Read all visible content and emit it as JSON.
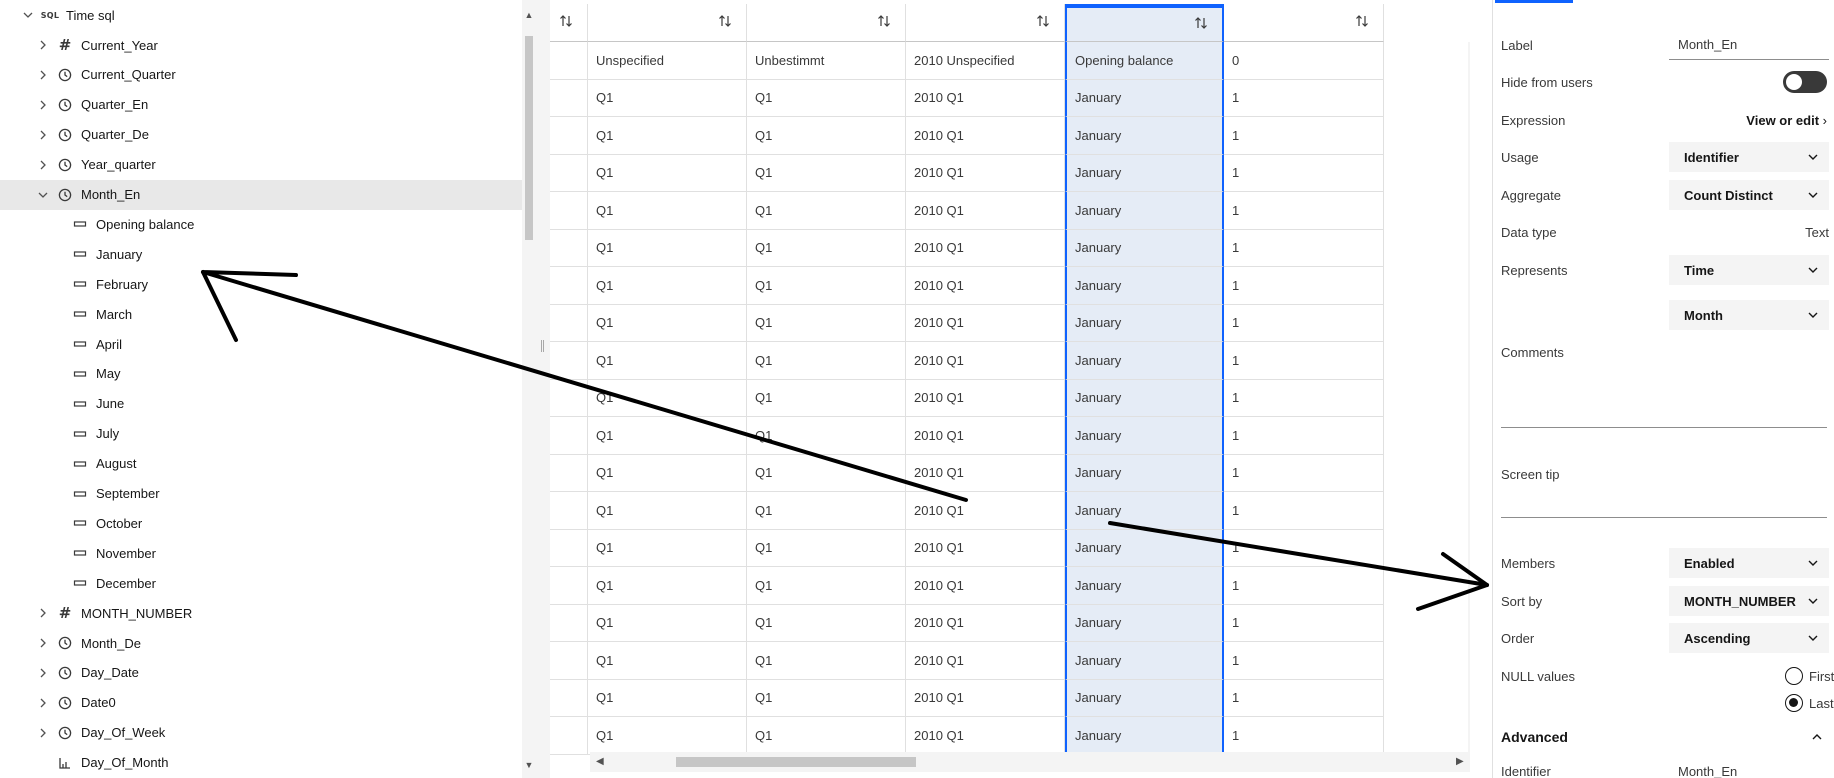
{
  "tree": {
    "root_label": "Time sql",
    "root_badge": "SQL",
    "items": [
      {
        "label": "Current_Year",
        "icon": "hash-icon",
        "expandable": true
      },
      {
        "label": "Current_Quarter",
        "icon": "clock-icon",
        "expandable": true
      },
      {
        "label": "Quarter_En",
        "icon": "clock-icon",
        "expandable": true
      },
      {
        "label": "Quarter_De",
        "icon": "clock-icon",
        "expandable": true
      },
      {
        "label": "Year_quarter",
        "icon": "clock-icon",
        "expandable": true
      },
      {
        "label": "Month_En",
        "icon": "clock-icon",
        "expandable": true,
        "expanded": true,
        "selected": true
      },
      {
        "label": "Opening balance",
        "icon": "member-icon",
        "child": true
      },
      {
        "label": "January",
        "icon": "member-icon",
        "child": true
      },
      {
        "label": "February",
        "icon": "member-icon",
        "child": true
      },
      {
        "label": "March",
        "icon": "member-icon",
        "child": true
      },
      {
        "label": "April",
        "icon": "member-icon",
        "child": true
      },
      {
        "label": "May",
        "icon": "member-icon",
        "child": true
      },
      {
        "label": "June",
        "icon": "member-icon",
        "child": true
      },
      {
        "label": "July",
        "icon": "member-icon",
        "child": true
      },
      {
        "label": "August",
        "icon": "member-icon",
        "child": true
      },
      {
        "label": "September",
        "icon": "member-icon",
        "child": true
      },
      {
        "label": "October",
        "icon": "member-icon",
        "child": true
      },
      {
        "label": "November",
        "icon": "member-icon",
        "child": true
      },
      {
        "label": "December",
        "icon": "member-icon",
        "child": true
      },
      {
        "label": "MONTH_NUMBER",
        "icon": "hash-icon",
        "expandable": true
      },
      {
        "label": "Month_De",
        "icon": "clock-icon",
        "expandable": true
      },
      {
        "label": "Day_Date",
        "icon": "clock-icon",
        "expandable": true
      },
      {
        "label": "Date0",
        "icon": "clock-icon",
        "expandable": true
      },
      {
        "label": "Day_Of_Week",
        "icon": "clock-icon",
        "expandable": true
      },
      {
        "label": "Day_Of_Month",
        "icon": "measure-icon",
        "expandable": false
      }
    ]
  },
  "grid": {
    "sort_icon": "sort-icon",
    "first_row": [
      "",
      "Unspecified",
      "Unbestimmt",
      "2010 Unspecified",
      "Opening balance",
      "0"
    ],
    "row_template": [
      "",
      "Q1",
      "Q1",
      "2010 Q1",
      "January",
      "1"
    ],
    "repeat_rows": 18,
    "selected_column": 4
  },
  "properties": {
    "label_label": "Label",
    "label_value": "Month_En",
    "hide_label": "Hide from users",
    "hide_value": false,
    "expression_label": "Expression",
    "expression_link": "View or edit",
    "usage_label": "Usage",
    "usage_value": "Identifier",
    "aggregate_label": "Aggregate",
    "aggregate_value": "Count Distinct",
    "datatype_label": "Data type",
    "datatype_value": "Text",
    "represents_label": "Represents",
    "represents_value": "Time",
    "represents_sub_value": "Month",
    "comments_label": "Comments",
    "screentip_label": "Screen tip",
    "members_label": "Members",
    "members_value": "Enabled",
    "sortby_label": "Sort by",
    "sortby_value": "MONTH_NUMBER",
    "order_label": "Order",
    "order_value": "Ascending",
    "nulls_label": "NULL values",
    "nulls_first": "First",
    "nulls_last": "Last",
    "nulls_selected": "Last",
    "advanced_label": "Advanced",
    "identifier_label": "Identifier",
    "identifier_value": "Month_En"
  },
  "colors": {
    "selection_blue": "#0f62fe",
    "selected_column_fill": "#e5ecf6",
    "selected_tree_row": "#e8e8e8"
  }
}
